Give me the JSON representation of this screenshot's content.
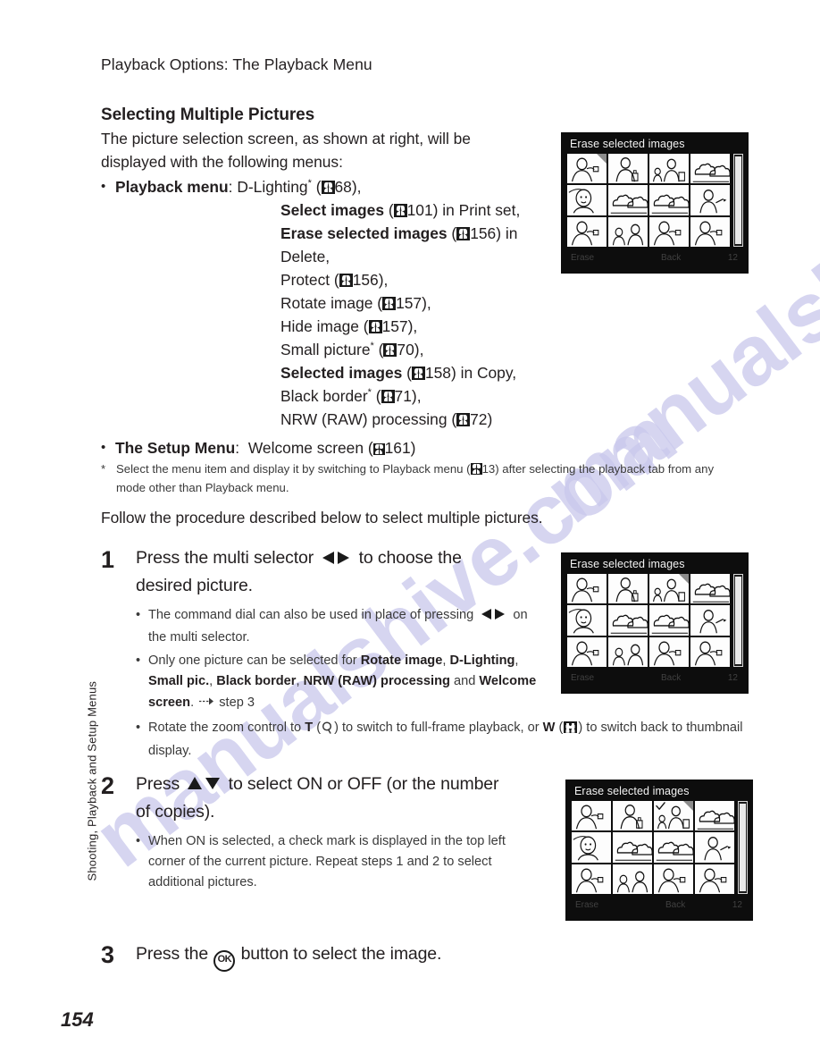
{
  "page": {
    "running_head": "Playback Options: The Playback Menu",
    "side_tab": "Shooting, Playback and Setup Menus",
    "page_number": "154",
    "watermark": "manualshive.com",
    "watermark_color": "#c9c8ec"
  },
  "section": {
    "title": "Selecting Multiple Pictures",
    "intro_line1": "The picture selection screen, as shown at right, will be",
    "intro_line2": "displayed with the following menus:"
  },
  "menu_list": {
    "playback_label": "Playback menu",
    "playback_colon": ":",
    "setup_label": "The Setup Menu",
    "setup_colon": ":",
    "setup_item": "Welcome screen",
    "setup_ref": "161",
    "items": [
      {
        "name": "D-Lighting",
        "star": true,
        "bold": false,
        "ref": "68",
        "suffix": ","
      },
      {
        "name": "Select images",
        "star": false,
        "bold": true,
        "ref": "101",
        "suffix": " in Print set,"
      },
      {
        "name": "Erase selected images",
        "star": false,
        "bold": true,
        "ref": "156",
        "suffix": " in"
      },
      {
        "name": "Delete,",
        "star": false,
        "bold": false,
        "ref": "",
        "suffix": ""
      },
      {
        "name": "Protect",
        "star": false,
        "bold": false,
        "ref": "156",
        "suffix": ","
      },
      {
        "name": "Rotate image",
        "star": false,
        "bold": false,
        "ref": "157",
        "suffix": ","
      },
      {
        "name": "Hide image",
        "star": false,
        "bold": false,
        "ref": "157",
        "suffix": ","
      },
      {
        "name": "Small picture",
        "star": true,
        "bold": false,
        "ref": "70",
        "suffix": ","
      },
      {
        "name": "Selected images",
        "star": false,
        "bold": true,
        "ref": "158",
        "suffix": " in Copy,"
      },
      {
        "name": "Black border",
        "star": true,
        "bold": false,
        "ref": "71",
        "suffix": ","
      },
      {
        "name": "NRW (RAW) processing",
        "star": false,
        "bold": false,
        "ref": "72",
        "suffix": ""
      }
    ]
  },
  "footnote": {
    "mark": "*",
    "line1_a": "Select the menu item and display it by switching to Playback menu (",
    "line1_ref": "13",
    "line1_b": ") after selecting the",
    "line2": "playback tab from any mode other than Playback menu."
  },
  "follow_line": "Follow the procedure described below to select multiple pictures.",
  "steps": [
    {
      "number": "1",
      "head_a": "Press the multi selector",
      "head_b": "to choose the",
      "head_c": "desired picture.",
      "bullets": [
        {
          "parts": [
            {
              "t": "The command dial can also be used in place of pressing",
              "b": false
            },
            {
              "t": "LR_ARROWS",
              "b": false
            },
            {
              "t": "on the multi selector.",
              "b": false
            }
          ]
        },
        {
          "parts": [
            {
              "t": "Only one picture can be selected for ",
              "b": false
            },
            {
              "t": "Rotate image",
              "b": true
            },
            {
              "t": ", ",
              "b": false
            },
            {
              "t": "D-Lighting",
              "b": true
            },
            {
              "t": ", ",
              "b": false
            },
            {
              "t": "Small pic.",
              "b": true
            },
            {
              "t": ", ",
              "b": false
            },
            {
              "t": "Black border",
              "b": true
            },
            {
              "t": ", ",
              "b": false
            },
            {
              "t": "NRW (RAW) processing",
              "b": true
            },
            {
              "t": " and ",
              "b": false
            },
            {
              "t": "Welcome screen",
              "b": true
            },
            {
              "t": ". ",
              "b": false
            },
            {
              "t": "ARROW_TO",
              "b": false
            },
            {
              "t": " step 3",
              "b": false
            }
          ]
        },
        {
          "parts": [
            {
              "t": "Rotate the zoom control to ",
              "b": false
            },
            {
              "t": "T",
              "b": true
            },
            {
              "t": " (MAG) to switch to full-frame playback, or ",
              "b": false
            },
            {
              "t": "W",
              "b": true
            },
            {
              "t": " (GRID) to switch back to thumbnail display.",
              "b": false
            }
          ]
        }
      ]
    },
    {
      "number": "2",
      "head_a": "Press",
      "head_b": "to select ON or OFF (or the number",
      "head_c": "of copies).",
      "bullets": [
        {
          "parts": [
            {
              "t": "When ON is selected, a check mark is displayed in the top left corner of the current picture. Repeat steps 1 and 2 to select additional pictures.",
              "b": false
            }
          ]
        }
      ]
    },
    {
      "number": "3",
      "head_a": "Press the",
      "head_b": "button to select the image.",
      "ok_label": "OK"
    }
  ],
  "lcd_screens": [
    {
      "title": "Erase selected images",
      "selected_index": 0,
      "checked_indices": [],
      "status_left": "Erase",
      "status_mid": "Back",
      "status_right": "12"
    },
    {
      "title": "Erase selected images",
      "selected_index": 2,
      "checked_indices": [],
      "status_left": "Erase",
      "status_mid": "Back",
      "status_right": "12"
    },
    {
      "title": "Erase selected images",
      "selected_index": 2,
      "checked_indices": [
        2
      ],
      "status_left": "Erase",
      "status_mid": "Back",
      "status_right": "12"
    }
  ],
  "icons": {
    "reference": "book-reference-icon",
    "left_right": "multi-selector-left-right-icon",
    "up_down": "multi-selector-up-down-icon",
    "ok": "ok-button-icon",
    "magnify": "magnify-icon",
    "thumbnail_grid": "thumbnail-grid-icon"
  }
}
